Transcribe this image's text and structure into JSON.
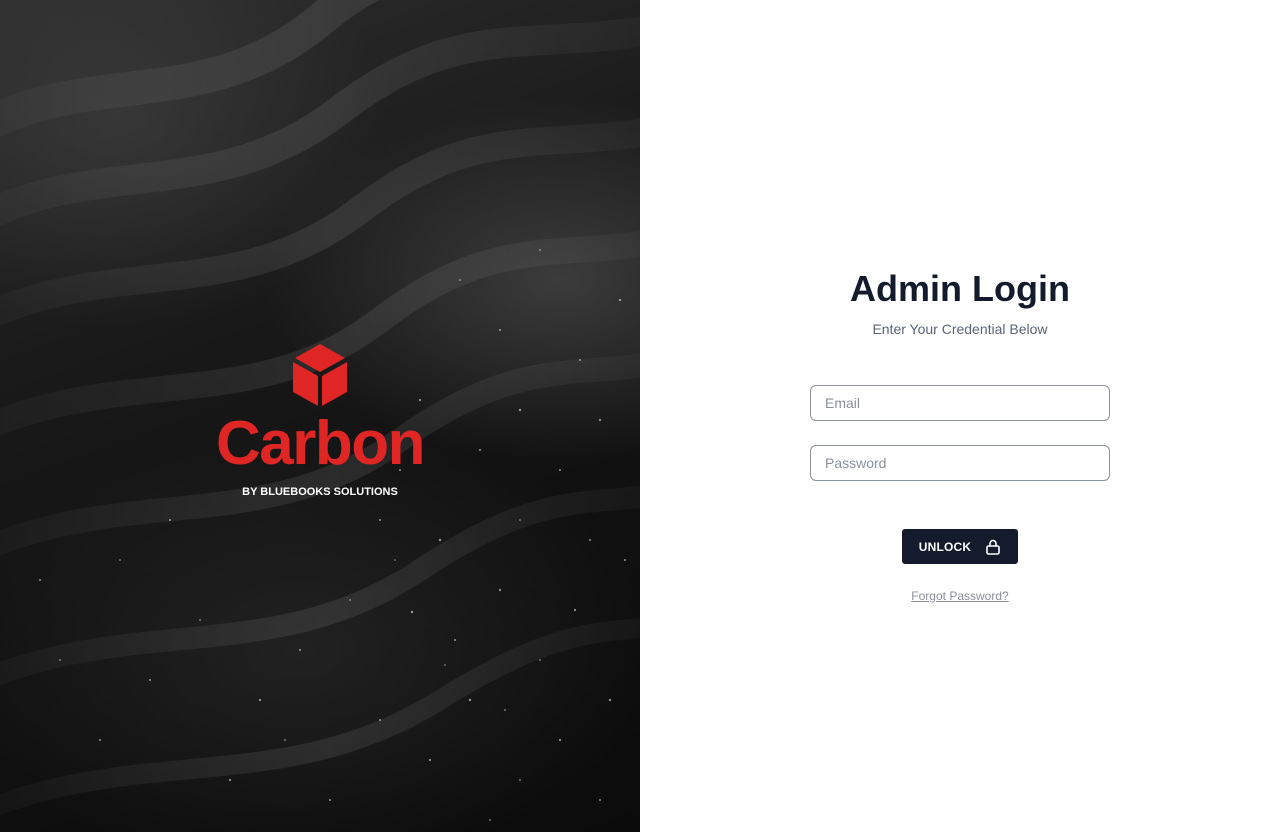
{
  "brand": {
    "name": "Carbon",
    "tagline": "BY BLUEBOOKS SOLUTIONS",
    "color": "#e02525"
  },
  "login": {
    "title": "Admin Login",
    "subtitle": "Enter Your Credential Below",
    "email_placeholder": "Email",
    "email_value": "",
    "password_placeholder": "Password",
    "password_value": "",
    "unlock_label": "UNLOCK",
    "unlock_icon": "lock-icon",
    "forgot_label": "Forgot Password?"
  },
  "theme": {
    "button_bg": "#141b2d",
    "title_color": "#141b2d",
    "background_left": "black-sand-texture"
  }
}
